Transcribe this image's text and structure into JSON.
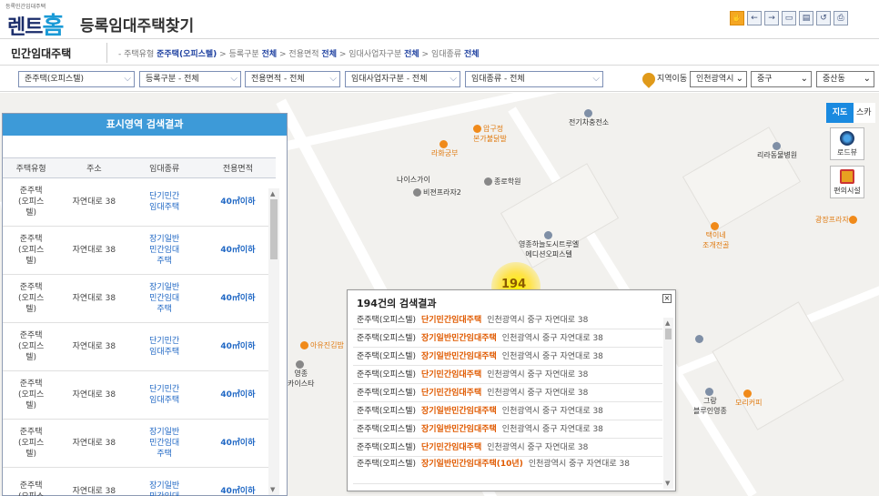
{
  "header": {
    "logo_small": "등록민간임대주택",
    "logo_main": "렌트",
    "logo_home": "홈",
    "title": "등록임대주택찾기"
  },
  "toolbar": {
    "icons": [
      "hand-icon",
      "back-icon",
      "forward-icon",
      "distance-icon",
      "area-icon",
      "reset-icon",
      "print-icon"
    ]
  },
  "crumb": {
    "title": "민간임대주택",
    "parts": [
      {
        "label": "- 주택유형",
        "value": "준주택(오피스텔)"
      },
      {
        "label": "> 등록구분",
        "value": "전체"
      },
      {
        "label": "> 전용면적",
        "value": "전체"
      },
      {
        "label": "> 임대사업자구분",
        "value": "전체"
      },
      {
        "label": "> 임대종류",
        "value": "전체"
      }
    ]
  },
  "filters": {
    "house_type": "준주택(오피스텔)",
    "reg_type": "등록구분 - 전체",
    "area": "전용면적 - 전체",
    "biz_type": "임대사업자구분 - 전체",
    "rent_type": "임대종류 - 전체",
    "region_label": "지역이동",
    "sido": "인천광역시",
    "sigungu": "중구",
    "dong": "중산동"
  },
  "map": {
    "map_button": "지도",
    "sky_button": "스카",
    "roadview": "로드뷰",
    "facilities": "편의시설",
    "cluster_count": "194",
    "pois": {
      "ev": "전기차충전소",
      "lila": "리라동물병원",
      "rahwa": "라화궁부",
      "apgujeong": "압구정\n본가불닭발",
      "nicegai": "나이스가이",
      "bijeon": "비젼프라자2",
      "jongno": "종로학원",
      "plaza": "광장프라자",
      "taeine": "택이네\n조개전골",
      "haneul": "영종하늘도시트루엘\n에디션오피스텔",
      "ayu": "아유진김밥",
      "yeongjong": "영종\n카이스타",
      "gram": "그랑\n블루인영종",
      "mori": "모리커피"
    }
  },
  "panel": {
    "title": "표시영역 검색결과",
    "columns": [
      "주택유형",
      "주소",
      "임대종류",
      "전용면적"
    ],
    "rows": [
      {
        "type": "준주택\n(오피스\n텔)",
        "addr": "자연대로 38",
        "kind": "단기민간\n임대주택",
        "area": "40㎡이하"
      },
      {
        "type": "준주택\n(오피스\n텔)",
        "addr": "자연대로 38",
        "kind": "장기일반\n민간임대\n주택",
        "area": "40㎡이하"
      },
      {
        "type": "준주택\n(오피스\n텔)",
        "addr": "자연대로 38",
        "kind": "장기일반\n민간임대\n주택",
        "area": "40㎡이하"
      },
      {
        "type": "준주택\n(오피스\n텔)",
        "addr": "자연대로 38",
        "kind": "단기민간\n임대주택",
        "area": "40㎡이하"
      },
      {
        "type": "준주택\n(오피스\n텔)",
        "addr": "자연대로 38",
        "kind": "단기민간\n임대주택",
        "area": "40㎡이하"
      },
      {
        "type": "준주택\n(오피스\n텔)",
        "addr": "자연대로 38",
        "kind": "장기일반\n민간임대\n주택",
        "area": "40㎡이하"
      },
      {
        "type": "준주택\n(오피스",
        "addr": "자연대로 38",
        "kind": "장기일반\n민간임대",
        "area": "40㎡이하"
      }
    ]
  },
  "popup": {
    "title": "194건의 검색결과",
    "rows": [
      {
        "type": "준주택(오피스텔)",
        "kind": "단기민간임대주택",
        "addr": "인천광역시 중구 자연대로 38"
      },
      {
        "type": "준주택(오피스텔)",
        "kind": "장기일반민간임대주택",
        "addr": "인천광역시 중구 자연대로 38"
      },
      {
        "type": "준주택(오피스텔)",
        "kind": "장기일반민간임대주택",
        "addr": "인천광역시 중구 자연대로 38"
      },
      {
        "type": "준주택(오피스텔)",
        "kind": "단기민간임대주택",
        "addr": "인천광역시 중구 자연대로 38"
      },
      {
        "type": "준주택(오피스텔)",
        "kind": "단기민간임대주택",
        "addr": "인천광역시 중구 자연대로 38"
      },
      {
        "type": "준주택(오피스텔)",
        "kind": "장기일반민간임대주택",
        "addr": "인천광역시 중구 자연대로 38"
      },
      {
        "type": "준주택(오피스텔)",
        "kind": "장기일반민간임대주택",
        "addr": "인천광역시 중구 자연대로 38"
      },
      {
        "type": "준주택(오피스텔)",
        "kind": "단기민간임대주택",
        "addr": "인천광역시 중구 자연대로 38"
      },
      {
        "type": "준주택(오피스텔)",
        "kind": "장기일반민간임대주택(10년)",
        "addr": "인천광역시 중구 자연대로 38"
      }
    ]
  }
}
